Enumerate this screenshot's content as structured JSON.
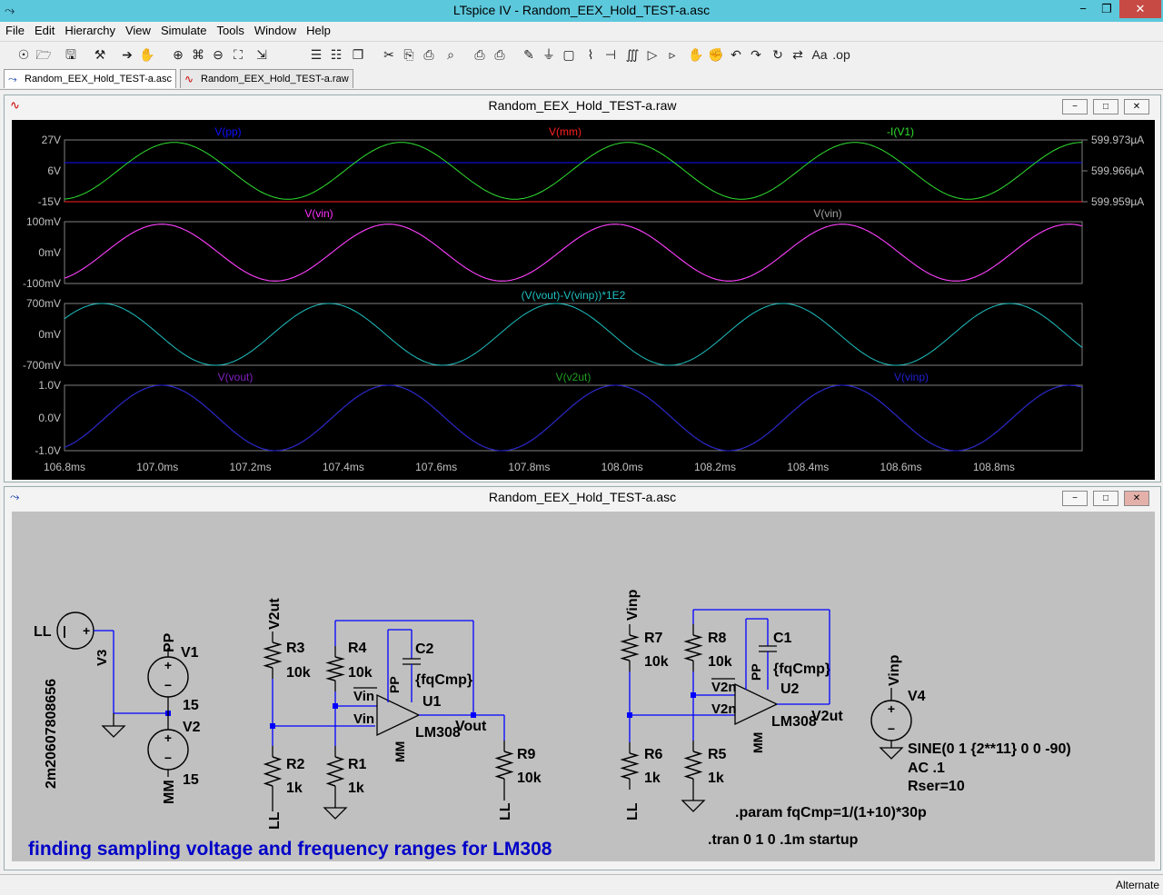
{
  "window": {
    "title": "LTspice IV - Random_EEX_Hold_TEST-a.asc"
  },
  "menu": [
    "File",
    "Edit",
    "Hierarchy",
    "View",
    "Simulate",
    "Tools",
    "Window",
    "Help"
  ],
  "tabs": [
    {
      "label": "Random_EEX_Hold_TEST-a.asc"
    },
    {
      "label": "Random_EEX_Hold_TEST-a.raw"
    }
  ],
  "toolbar_icons": [
    "new-schematic-icon",
    "open-icon",
    "save-icon",
    "control-panel-icon",
    "run-icon",
    "halt-icon",
    "zoom-in-icon",
    "zoom-pan-icon",
    "zoom-out-icon",
    "zoom-fit-icon",
    "autorange-icon",
    "tile-horizontal-icon",
    "tile-vertical-icon",
    "cascade-icon",
    "cut-icon",
    "copy-icon",
    "paste-icon",
    "find-icon",
    "print-setup-icon",
    "print-icon",
    "draw-wire-icon",
    "ground-icon",
    "label-net-icon",
    "resistor-icon",
    "capacitor-icon",
    "inductor-icon",
    "diode-icon",
    "component-icon",
    "move-icon",
    "drag-icon",
    "undo-icon",
    "redo-icon",
    "rotate-icon",
    "mirror-icon",
    "text-icon",
    "spice-directive-icon"
  ],
  "waveform": {
    "title": "Random_EEX_Hold_TEST-a.raw",
    "x_ticks": [
      "106.8ms",
      "107.0ms",
      "107.2ms",
      "107.4ms",
      "107.6ms",
      "107.8ms",
      "108.0ms",
      "108.2ms",
      "108.4ms",
      "108.6ms",
      "108.8ms"
    ],
    "panes": [
      {
        "left_ticks": [
          "27V",
          "6V",
          "-15V"
        ],
        "right_ticks": [
          "599.973µA",
          "599.966µA",
          "599.959µA"
        ],
        "traces": [
          {
            "label": "V(pp)",
            "color": "#1010ff"
          },
          {
            "label": "V(mm)",
            "color": "#ff2020"
          },
          {
            "label": "-I(V1)",
            "color": "#30e030"
          }
        ]
      },
      {
        "left_ticks": [
          "100mV",
          "0mV",
          "-100mV"
        ],
        "traces": [
          {
            "label": "V(vin)",
            "color": "#ff30ff"
          },
          {
            "label": "V(vin)",
            "color": "#a0a0a0"
          }
        ]
      },
      {
        "left_ticks": [
          "700mV",
          "0mV",
          "-700mV"
        ],
        "traces": [
          {
            "label": "(V(vout)-V(vinp))*1E2",
            "color": "#20c0c0"
          }
        ]
      },
      {
        "left_ticks": [
          "1.0V",
          "0.0V",
          "-1.0V"
        ],
        "traces": [
          {
            "label": "V(vout)",
            "color": "#8020c0"
          },
          {
            "label": "V(v2ut)",
            "color": "#20a020"
          },
          {
            "label": "V(vinp)",
            "color": "#2020d0"
          }
        ]
      }
    ]
  },
  "schematic": {
    "title": "Random_EEX_Hold_TEST-a.asc",
    "labels": {
      "LL1": "LL",
      "src_value": "2m20607808656",
      "V3": "V3",
      "PP1": "PP",
      "V1": "V1",
      "v1_val": "15",
      "V2": "V2",
      "v2_val": "15",
      "MM1": "MM",
      "V2ut": "V2ut",
      "R3": "R3",
      "R3v": "10k",
      "R4": "R4",
      "R4v": "10k",
      "C2": "C2",
      "fq1": "{fqCmp}",
      "U1": "U1",
      "LM308a": "LM308",
      "PPu1": "PP",
      "MMu1": "MM",
      "Vin1": "Vin",
      "Vin2": "Vin",
      "Vout": "Vout",
      "R9": "R9",
      "R9v": "10k",
      "R2": "R2",
      "R2v": "1k",
      "R1": "R1",
      "R1v": "1k",
      "LL2": "LL",
      "LL3": "LL",
      "Vinp": "Vinp",
      "R7": "R7",
      "R7v": "10k",
      "R8": "R8",
      "R8v": "10k",
      "C1": "C1",
      "fq2": "{fqCmp}",
      "U2": "U2",
      "LM308b": "LM308",
      "PPu2": "PP",
      "MMu2": "MM",
      "V2n1": "V2n",
      "V2n2": "V2n",
      "V2ut2": "V2ut",
      "R6": "R6",
      "R6v": "1k",
      "R5": "R5",
      "R5v": "1k",
      "LL4": "LL",
      "Vinp2": "Vinp",
      "V4": "V4",
      "sine": "SINE(0 1 {2**11} 0 0 -90)",
      "ac": "AC .1",
      "rser": "Rser=10",
      "param": ".param fqCmp=1/(1+10)*30p",
      "tran": ".tran 0 1 0 .1m startup",
      "comment": "finding sampling voltage and frequency ranges for LM308"
    }
  },
  "status": {
    "text": "Alternate"
  },
  "colors": {
    "titlebar": "#5cc8dc",
    "plot_bg": "#000000",
    "schematic_bg": "#c0c0c0",
    "wire": "#0000ff",
    "text_blue": "#0000c8"
  }
}
